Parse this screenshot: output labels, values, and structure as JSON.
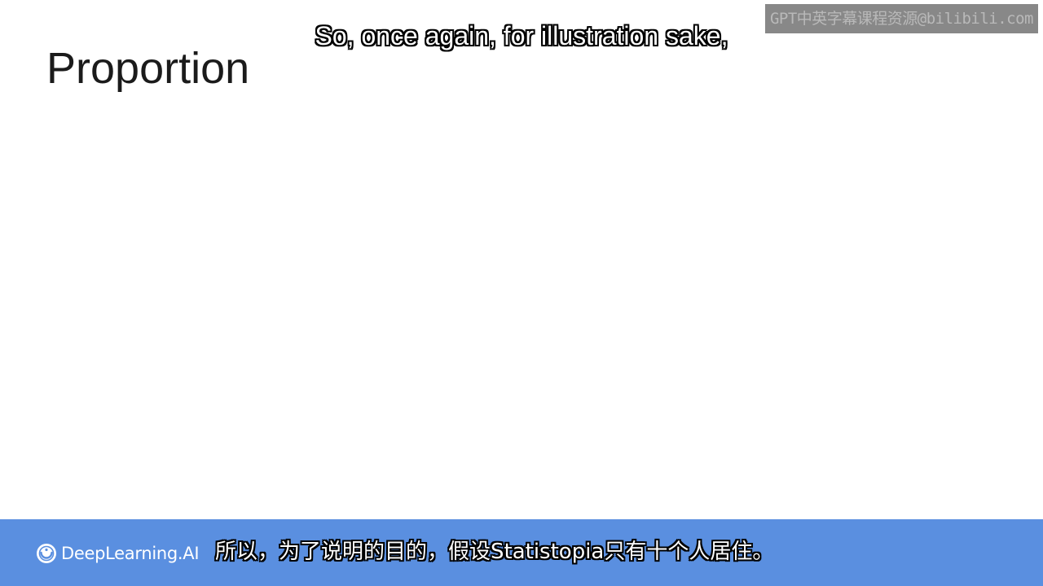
{
  "slide": {
    "title": "Proportion"
  },
  "subtitles": {
    "english": "So, once again, for illustration sake,",
    "chinese": "所以，为了说明的目的，假设Statistopia只有十个人居住。"
  },
  "watermark": {
    "text": "GPT中英字幕课程资源@bilibili.com"
  },
  "footer": {
    "brand": "DeepLearning.AI",
    "logo_icon": "deeplearning-logo-icon",
    "bar_color": "#5a8fe0"
  }
}
